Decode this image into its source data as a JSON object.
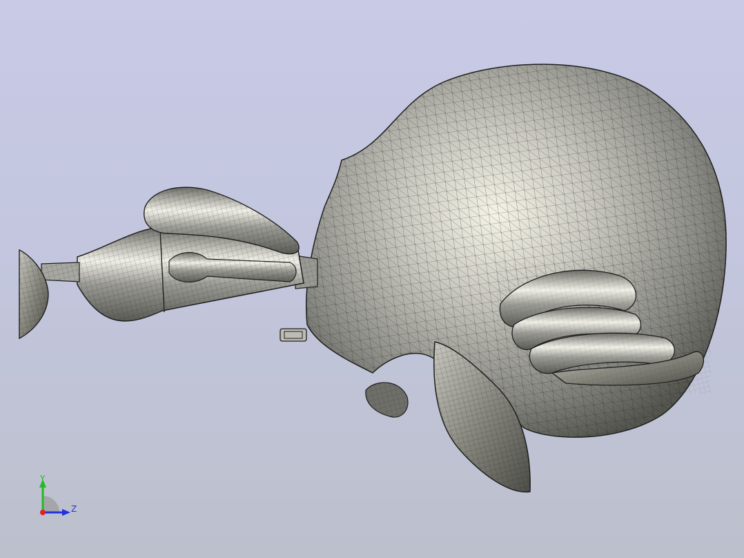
{
  "viewport": {
    "background_top": "#c9cae6",
    "background_bottom": "#bcc0cc",
    "model_color": "#8d8d88",
    "mesh_color": "#1e1e1e"
  },
  "triad": {
    "y_label": "Y",
    "z_label": "Z",
    "y_color": "#22bb22",
    "z_color": "#2233dd",
    "x_color": "#dd2222"
  }
}
